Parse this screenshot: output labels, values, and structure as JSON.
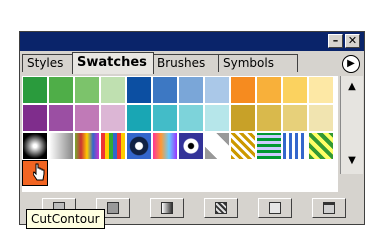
{
  "panel": {
    "tabs": [
      "Styles",
      "Swatches",
      "Brushes",
      "Symbols"
    ],
    "active_tab": "Swatches",
    "minimize_label": "–",
    "close_label": "✕",
    "menu_label": "▶"
  },
  "swatch_rows": [
    [
      "#2a9b3d",
      "#4fae48",
      "#7cc36b",
      "#bfe0b0",
      "#0c4fa2",
      "#3d78c3",
      "#7aa6d8",
      "#aac8e8",
      "#f68b1f",
      "#f8b03a",
      "#fbd25f",
      "#fde8a5"
    ],
    [
      "#7f2d8c",
      "#9b4fa3",
      "#c07ab7",
      "#dcb6d5",
      "#19a6b4",
      "#43bcc8",
      "#7dd3da",
      "#b6e6ea",
      "#c8a128",
      "#d9b94c",
      "#e7d07a",
      "#f1e4b0"
    ]
  ],
  "pattern_row": [
    "radial-dark",
    "gradient-gray",
    "rainbow-bars",
    "color-bars",
    "blue-dot",
    "multicolor",
    "bullseye",
    "diamond",
    "pattern-stars",
    "pattern-stripes",
    "pattern-plaid",
    "pattern-green"
  ],
  "selected_swatch": {
    "color": "#f26522"
  },
  "bottom_buttons": [
    "show-swatch-kinds-icon",
    "show-color-icon",
    "show-gradient-icon",
    "show-pattern-icon",
    "new-swatch-icon",
    "delete-swatch-icon"
  ],
  "tooltip": "CutContour",
  "scroll": {
    "up": "▲",
    "down": "▼"
  }
}
